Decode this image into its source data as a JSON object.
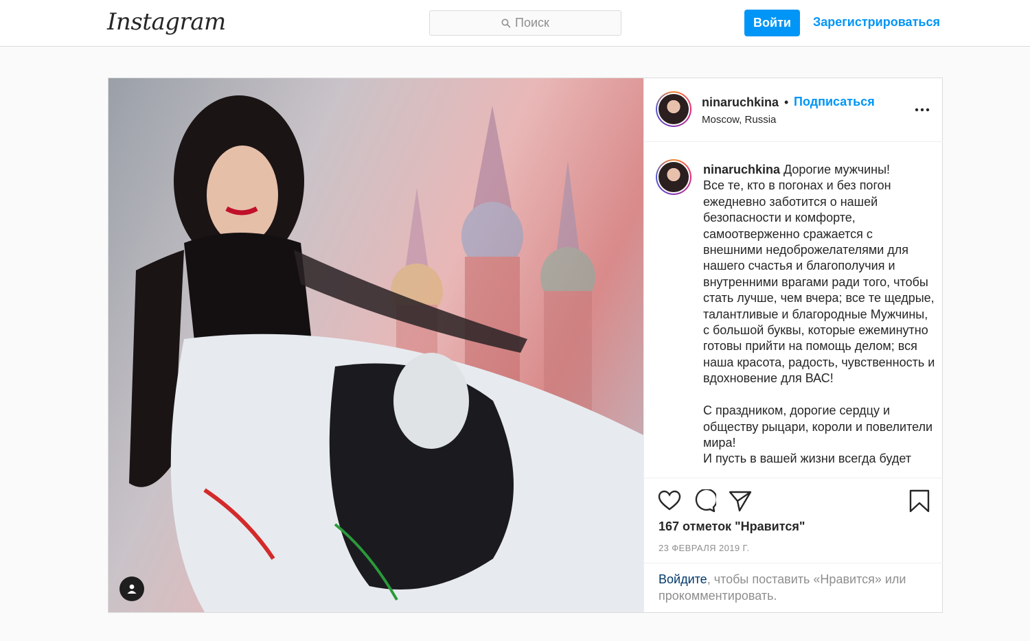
{
  "header": {
    "logo_text": "Instagram",
    "search_placeholder": "Поиск",
    "login_label": "Войти",
    "signup_label": "Зарегистрироваться"
  },
  "post": {
    "username": "ninaruchkina",
    "dot": "•",
    "follow_label": "Подписаться",
    "location": "Moscow, Russia",
    "caption_user": "ninaruchkina",
    "caption_text": " Дорогие мужчины!\nВсе те, кто в погонах и без погон ежедневно заботится о нашей безопасности и комфорте, самоотверженно сражается с внешними недоброжелателями для нашего счастья и благополучия и внутренними врагами ради того, чтобы стать лучше, чем вчера; все те щедрые, талантливые и благородные Мужчины, с большой буквы, которые ежеминутно готовы прийти на помощь делом; вся наша красота, радость, чувственность и вдохновение для ВАС!\n\nС праздником, дорогие сердцу и обществу рыцари, короли и повелители мира!\nИ пусть в вашей жизни всегда будет",
    "likes": "167 отметок \"Нравится\"",
    "date": "23 ФЕВРАЛЯ 2019 Г.",
    "footer_link": "Войдите",
    "footer_text": ", чтобы поставить «Нравится» или прокомментировать."
  },
  "icons": {
    "search": "search-icon",
    "more": "more-options-icon",
    "like": "heart-icon",
    "comment": "comment-icon",
    "share": "send-icon",
    "save": "bookmark-icon",
    "user_tag": "user-tag-icon"
  },
  "colors": {
    "accent": "#0095f6",
    "link_dark": "#00376b",
    "muted": "#8e8e8e",
    "border": "#dbdbdb"
  }
}
